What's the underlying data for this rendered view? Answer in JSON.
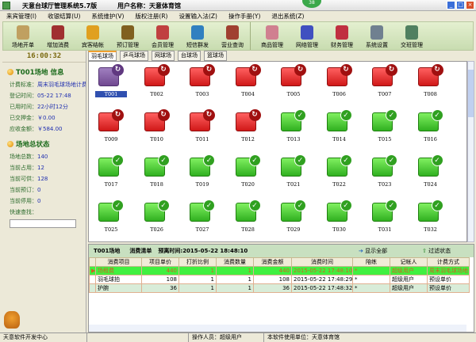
{
  "window": {
    "title": "天意台球厅管理系统5.7版",
    "user": "用户名称：天意体育馆",
    "badge": "38"
  },
  "menu": [
    "来宾管理(I)",
    "收银结算(U)",
    "系统维护(V)",
    "版权注册(R)",
    "设置输入法(Z)",
    "操作手册(Y)",
    "退出系统(Z)"
  ],
  "toolbar": [
    {
      "label": "场地开单",
      "color": "#c0a060"
    },
    {
      "label": "增加消费",
      "color": "#a03030"
    },
    {
      "label": "宾客结帐",
      "color": "#e0a020"
    },
    {
      "label": "预订管理",
      "color": "#806020"
    },
    {
      "label": "会员管理",
      "color": "#c04040"
    },
    {
      "label": "短信群发",
      "color": "#3080c0"
    },
    {
      "label": "营业查询",
      "color": "#a04030"
    }
  ],
  "toolbar2": [
    {
      "label": "商品管理",
      "color": "#d08090"
    },
    {
      "label": "网络管理",
      "color": "#4050c0"
    },
    {
      "label": "财务管理",
      "color": "#c03040"
    },
    {
      "label": "系统设置",
      "color": "#708090"
    },
    {
      "label": "交班管理",
      "color": "#508060"
    }
  ],
  "clock": "16:00:32",
  "info": {
    "title": "T001场地 信息",
    "rate_label": "计费标准：",
    "rate": "周末羽毛球场地计费",
    "reg_label": "登记时间：",
    "reg": "05-22 17:48",
    "used_label": "已用时间：",
    "used": "22小时12分",
    "deposit_label": "已交押金：",
    "deposit": "￥0.00",
    "due_label": "应收金额：",
    "due": "￥584.00"
  },
  "status": {
    "title": "场地总状态",
    "total_label": "场地总数：",
    "total": "140",
    "occupied_label": "当前占用：",
    "occupied": "12",
    "available_label": "当前可供：",
    "available": "128",
    "reserved_label": "当前预订：",
    "reserved": "0",
    "stopped_label": "当前停用：",
    "stopped": "0",
    "search_label": "快速查找："
  },
  "tabs": [
    "羽毛球场",
    "乒乓球场",
    "网球场",
    "台球场",
    "篮球场"
  ],
  "courts": [
    {
      "id": "T001",
      "status": "selected"
    },
    {
      "id": "T002",
      "status": "busy"
    },
    {
      "id": "T003",
      "status": "busy"
    },
    {
      "id": "T004",
      "status": "busy"
    },
    {
      "id": "T005",
      "status": "busy"
    },
    {
      "id": "T006",
      "status": "busy"
    },
    {
      "id": "T007",
      "status": "busy"
    },
    {
      "id": "T008",
      "status": "busy"
    },
    {
      "id": "T009",
      "status": "busy"
    },
    {
      "id": "T010",
      "status": "busy"
    },
    {
      "id": "T011",
      "status": "busy"
    },
    {
      "id": "T012",
      "status": "busy"
    },
    {
      "id": "T013",
      "status": "free"
    },
    {
      "id": "T014",
      "status": "free"
    },
    {
      "id": "T015",
      "status": "free"
    },
    {
      "id": "T016",
      "status": "free"
    },
    {
      "id": "T017",
      "status": "free"
    },
    {
      "id": "T018",
      "status": "free"
    },
    {
      "id": "T019",
      "status": "free"
    },
    {
      "id": "T020",
      "status": "free"
    },
    {
      "id": "T021",
      "status": "free"
    },
    {
      "id": "T022",
      "status": "free"
    },
    {
      "id": "T023",
      "status": "free"
    },
    {
      "id": "T024",
      "status": "free"
    },
    {
      "id": "T025",
      "status": "free"
    },
    {
      "id": "T026",
      "status": "free"
    },
    {
      "id": "T027",
      "status": "free"
    },
    {
      "id": "T028",
      "status": "free"
    },
    {
      "id": "T029",
      "status": "free"
    },
    {
      "id": "T030",
      "status": "free"
    },
    {
      "id": "T031",
      "status": "free"
    },
    {
      "id": "T032",
      "status": "free"
    }
  ],
  "bill": {
    "court": "T001场地",
    "title": "消费清单",
    "time": "预离时间:2015-05-22 18:48:10",
    "show_all": "显示全部",
    "filter": "过滤状态",
    "columns": [
      "消费项目",
      "项目单价",
      "打折比例",
      "消费数量",
      "消费金额",
      "消费时间",
      "陪练",
      "记帐人",
      "计费方式"
    ],
    "rows": [
      [
        "场租费",
        "440",
        "1",
        "1",
        "440",
        "2015-05-22 17:48:10",
        "*",
        "超级用户",
        "周末羽毛球场地"
      ],
      [
        "羽毛球拍",
        "108",
        "1",
        "1",
        "108",
        "2015-05-22 17:48:29",
        "*",
        "超级用户",
        "预设单价"
      ],
      [
        "护腕",
        "36",
        "1",
        "1",
        "36",
        "2015-05-22 17:48:32",
        "*",
        "超级用户",
        "预设单价"
      ]
    ]
  },
  "statusbar": {
    "dev": "天意软件开发中心",
    "operator": "操作人员：超级用户",
    "unit": "本软件使用单位：天意体育馆"
  }
}
